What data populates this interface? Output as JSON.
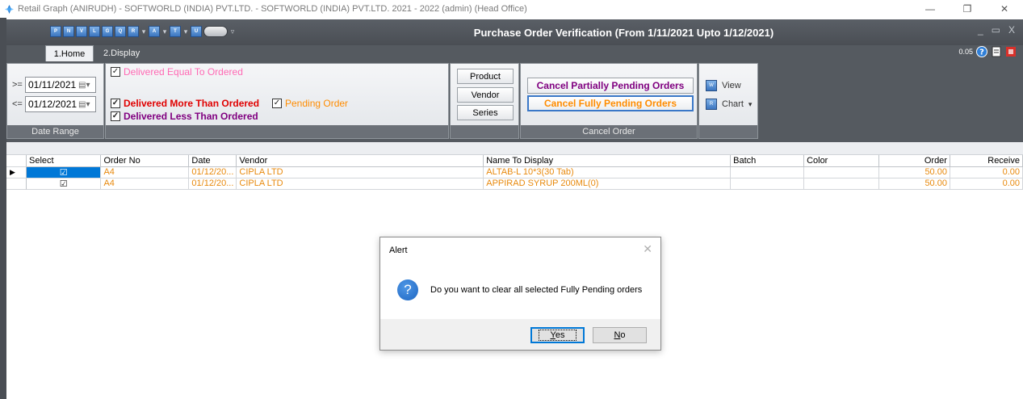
{
  "os_window": {
    "title": "Retail Graph (ANIRUDH) - SOFTWORLD (INDIA) PVT.LTD. - SOFTWORLD (INDIA) PVT.LTD.  2021 - 2022 (admin) (Head Office)",
    "minimize": "—",
    "maximize": "❐",
    "close": "✕"
  },
  "app": {
    "orb_letter": "S",
    "window_title": "Purchase Order Verification (From 1/11/2021 Upto 1/12/2021)",
    "quick_access": [
      "P",
      "N",
      "V",
      "L",
      "G",
      "Q",
      "R",
      "A",
      "T",
      "U"
    ],
    "win_minimize": "_",
    "win_restore": "▭",
    "win_close": "X"
  },
  "tabs": [
    {
      "label": "1.Home",
      "active": true
    },
    {
      "label": "2.Display",
      "active": false
    }
  ],
  "right_tools": {
    "version": "0.05"
  },
  "date_range": {
    "label": "Date Range",
    "from_op": ">=",
    "from_value": "01/11/2021",
    "to_op": "<=",
    "to_value": "01/12/2021"
  },
  "filters": {
    "equal": {
      "label": "Delivered Equal To Ordered",
      "checked": true,
      "color": "#ff69b4"
    },
    "more": {
      "label": "Delivered More Than Ordered",
      "checked": true,
      "color": "#e00000"
    },
    "less": {
      "label": "Delivered Less Than Ordered",
      "checked": true,
      "color": "#800080"
    },
    "pending": {
      "label": "Pending Order",
      "checked": true,
      "color": "#ff8c00"
    }
  },
  "group_by": {
    "product": "Product",
    "vendor": "Vendor",
    "series": "Series"
  },
  "cancel_order": {
    "label": "Cancel Order",
    "partial": {
      "label": "Cancel Partially Pending Orders",
      "color": "#800080"
    },
    "full": {
      "label": "Cancel Fully Pending Orders",
      "color": "#ff8c00"
    }
  },
  "view_group": {
    "view": "View",
    "chart": "Chart"
  },
  "grid": {
    "columns": [
      "Select",
      "Order No",
      "Date",
      "Vendor",
      "Name To Display",
      "Batch",
      "Color",
      "Order",
      "Receive"
    ],
    "rows": [
      {
        "select": "☑",
        "order_no": "A4",
        "date": "01/12/20...",
        "vendor": "CIPLA LTD",
        "name": "ALTAB-L 10*3(30 Tab)",
        "batch": "",
        "color": "",
        "order": "50.00",
        "receive": "0.00",
        "current": true
      },
      {
        "select": "☑",
        "order_no": "A4",
        "date": "01/12/20...",
        "vendor": "CIPLA LTD",
        "name": "APPIRAD SYRUP 200ML(0)",
        "batch": "",
        "color": "",
        "order": "50.00",
        "receive": "0.00",
        "current": false
      }
    ],
    "row_indicator": "▶"
  },
  "dialog": {
    "title": "Alert",
    "close": "✕",
    "icon": "?",
    "message": "Do you want to clear all selected Fully Pending orders",
    "yes_rest": "es",
    "yes_key": "Y",
    "no_rest": "o",
    "no_key": "N"
  }
}
